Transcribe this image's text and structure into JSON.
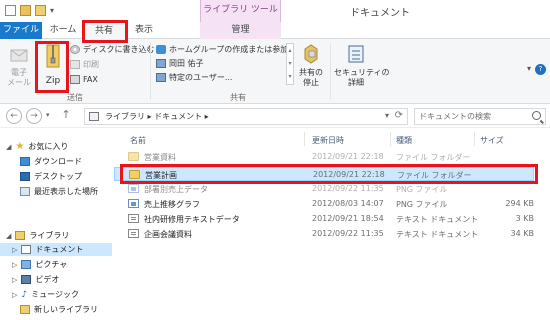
{
  "window": {
    "title": "ドキュメント",
    "context_group": "ライブラリ ツール"
  },
  "tabs": {
    "file": "ファイル",
    "home": "ホーム",
    "share": "共有",
    "view": "表示",
    "manage": "管理"
  },
  "ribbon": {
    "send": {
      "email_label": "電子\nメール",
      "zip_label": "Zip",
      "burn_label": "ディスクに書き込む",
      "print_label": "印刷",
      "fax_label": "FAX",
      "group_label": "送信"
    },
    "share_with": {
      "homegroup_label": "ホームグループの作成または参加",
      "user_label": "岡田 佑子",
      "specific_user_label": "特定のユーザー...",
      "stop_sharing_label": "共有の\n停止",
      "group_label": "共有"
    },
    "security": {
      "advanced_label": "セキュリティの\n詳細"
    }
  },
  "address": {
    "path": "ライブラリ  ▸  ドキュメント  ▸",
    "search_placeholder": "ドキュメントの検索"
  },
  "nav": {
    "favorites": "お気に入り",
    "downloads": "ダウンロード",
    "desktop": "デスクトップ",
    "recent": "最近表示した場所",
    "libraries": "ライブラリ",
    "documents": "ドキュメント",
    "pictures": "ピクチャ",
    "videos": "ビデオ",
    "music": "ミュージック",
    "new_library": "新しいライブラリ"
  },
  "columns": {
    "name": "名前",
    "modified": "更新日時",
    "type": "種類",
    "size": "サイズ"
  },
  "files": [
    {
      "name": "営業資料",
      "modified": "2012/09/21 22:18",
      "type": "ファイル フォルダー",
      "size": "",
      "icon": "folder-icon"
    },
    {
      "name": "営業計画",
      "modified": "2012/09/21 22:18",
      "type": "ファイル フォルダー",
      "size": "",
      "icon": "folder-icon"
    },
    {
      "name": "部署別売上データ",
      "modified": "2012/09/22 11:35",
      "type": "PNG ファイル",
      "size": "",
      "icon": "png-file-icon"
    },
    {
      "name": "売上推移グラフ",
      "modified": "2012/08/03 14:07",
      "type": "PNG ファイル",
      "size": "294 KB",
      "icon": "png-file-icon"
    },
    {
      "name": "社内研修用テキストデータ",
      "modified": "2012/09/21 18:54",
      "type": "テキスト ドキュメント",
      "size": "3 KB",
      "icon": "text-file-icon"
    },
    {
      "name": "企画会議資料",
      "modified": "2012/09/22 11:35",
      "type": "テキスト ドキュメント",
      "size": "34 KB",
      "icon": "text-file-icon"
    }
  ],
  "colors": {
    "accent": "#1979ca",
    "highlight": "#e8141b",
    "selection": "#cce8ff",
    "context_tab": "#f5e3f5"
  }
}
